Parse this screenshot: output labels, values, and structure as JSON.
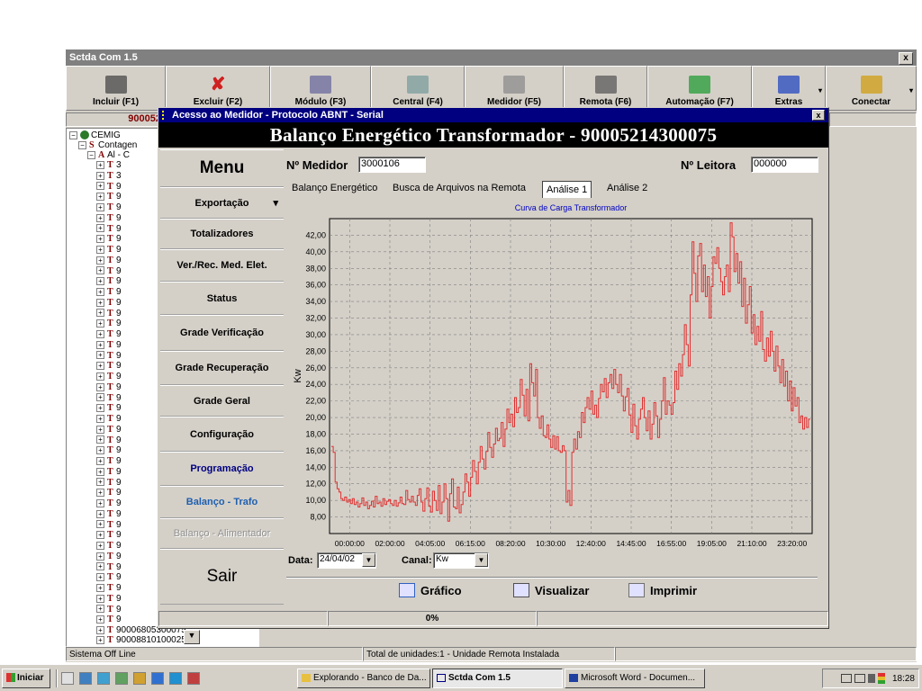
{
  "main_window": {
    "title": "Sctda Com 1.5",
    "close": "x"
  },
  "toolbar": [
    {
      "label": "Incluir (F1)",
      "icon": "document-icon",
      "width": 111
    },
    {
      "label": "Excluir (F2)",
      "icon": "delete-x-icon",
      "width": 116
    },
    {
      "label": "Módulo (F3)",
      "icon": "module-icon",
      "width": 112
    },
    {
      "label": "Central (F4)",
      "icon": "central-icon",
      "width": 104
    },
    {
      "label": "Medidor (F5)",
      "icon": "meter-icon",
      "width": 110
    },
    {
      "label": "Remota (F6)",
      "icon": "remote-icon",
      "width": 93
    },
    {
      "label": "Automação (F7)",
      "icon": "automation-icon",
      "width": 116
    },
    {
      "label": "Extras",
      "icon": "extras-icon",
      "width": 82
    },
    {
      "label": "Conectar",
      "icon": "connect-icon",
      "width": 101
    }
  ],
  "id_box": "900052",
  "tree": {
    "root": "CEMIG",
    "l1": "Contagen",
    "l2": "Al - C",
    "item_digits": [
      "3",
      "3",
      "9",
      "9",
      "9",
      "9",
      "9",
      "9",
      "9",
      "9",
      "9",
      "9",
      "9",
      "9",
      "9",
      "9",
      "9",
      "9",
      "9",
      "9",
      "9",
      "9",
      "9",
      "9",
      "9",
      "9",
      "9",
      "9",
      "9",
      "9",
      "9",
      "9",
      "9",
      "9",
      "9",
      "9",
      "9",
      "9",
      "9",
      "9",
      "9",
      "9",
      "9",
      "9"
    ],
    "bottom_items": [
      "90006805300075",
      "90008810100025"
    ]
  },
  "statusbar": {
    "left": "Sistema Off Line",
    "center": "Total de unidades:1  -  Unidade Remota Instalada"
  },
  "dialog": {
    "title": "Acesso ao Medidor - Protocolo ABNT - Serial",
    "close": "x",
    "banner": "Balanço Energético Transformador - 90005214300075",
    "menu_title": "Menu",
    "menu": [
      {
        "label": "Exportação",
        "arrow": "▾",
        "enabled": true
      },
      {
        "label": "Totalizadores",
        "enabled": true
      },
      {
        "label": "Ver./Rec. Med. Elet.",
        "enabled": true
      },
      {
        "label": "Status",
        "enabled": true
      },
      {
        "label": "Grade Verificação",
        "enabled": true
      },
      {
        "label": "Grade Recuperação",
        "enabled": true
      },
      {
        "label": "Grade Geral",
        "enabled": true
      },
      {
        "label": "Configuração",
        "enabled": true
      },
      {
        "label": "Programação",
        "enabled": true,
        "color": "#000080"
      },
      {
        "label": "Balanço - Trafo",
        "enabled": true,
        "color": "#1f5fb0"
      },
      {
        "label": "Balanço - Alimentador",
        "enabled": false
      }
    ],
    "exit": "Sair",
    "medidor_label": "Nº Medidor",
    "medidor_value": "3000106",
    "leitora_label": "Nº Leitora",
    "leitora_value": "000000",
    "tabs": [
      "Balanço Energético",
      "Busca de Arquivos na Remota",
      "Análise 1",
      "Análise 2"
    ],
    "active_tab": 2,
    "date_label": "Data:",
    "date_value": "24/04/02",
    "canal_label": "Canal:",
    "canal_value": "Kw",
    "buttons": [
      {
        "label": "Gráfico",
        "icon": "chart-icon"
      },
      {
        "label": "Visualizar",
        "icon": "magnifier-icon"
      },
      {
        "label": "Imprimir",
        "icon": "printer-icon"
      }
    ],
    "progress": "0%"
  },
  "chart_data": {
    "type": "line",
    "title": "Curva de Carga Transformador",
    "ylabel": "Kw",
    "xlabel": "",
    "ylim": [
      6,
      44
    ],
    "ytick_labels": [
      "8,00",
      "10,00",
      "12,00",
      "14,00",
      "16,00",
      "18,00",
      "20,00",
      "22,00",
      "24,00",
      "26,00",
      "28,00",
      "30,00",
      "32,00",
      "34,00",
      "36,00",
      "38,00",
      "40,00",
      "42,00"
    ],
    "xtick_labels": [
      "00:00:00",
      "02:00:00",
      "04:05:00",
      "06:15:00",
      "08:20:00",
      "10:30:00",
      "12:40:00",
      "14:45:00",
      "16:55:00",
      "19:05:00",
      "21:10:00",
      "23:20:00"
    ],
    "color": "#e03030",
    "grid": true,
    "values": [
      16.5,
      15.8,
      12.2,
      11.4,
      11.0,
      10.2,
      10.0,
      10.4,
      9.8,
      10.1,
      9.6,
      10.2,
      9.5,
      9.8,
      9.2,
      9.6,
      10.3,
      9.4,
      9.8,
      9.0,
      9.4,
      9.9,
      9.2,
      10.5,
      9.6,
      9.8,
      9.3,
      10.2,
      9.5,
      9.9,
      10.1,
      9.6,
      9.4,
      10.0,
      9.3,
      9.7,
      10.4,
      9.6,
      9.5,
      11.2,
      10.1,
      9.8,
      10.5,
      9.8,
      9.4,
      10.6,
      11.4,
      9.8,
      8.7,
      10.2,
      11.5,
      9.3,
      8.6,
      11.1,
      10.0,
      8.8,
      11.8,
      8.4,
      9.8,
      12.0,
      10.2,
      7.5,
      10.8,
      12.6,
      9.2,
      9.0,
      11.6,
      8.5,
      9.5,
      11.0,
      13.2,
      12.2,
      10.5,
      12.8,
      14.8,
      13.5,
      12.0,
      14.6,
      16.5,
      15.0,
      13.8,
      15.9,
      18.2,
      16.4,
      15.2,
      16.8,
      18.7,
      17.2,
      17.5,
      19.4,
      16.5,
      18.6,
      21.0,
      19.4,
      20.4,
      18.9,
      22.4,
      20.6,
      21.2,
      24.6,
      22.7,
      20.2,
      23.4,
      19.6,
      26.5,
      24.2,
      22.6,
      25.8,
      20.0,
      18.7,
      20.2,
      17.8,
      17.6,
      19.1,
      17.4,
      16.4,
      17.8,
      16.2,
      17.7,
      16.0,
      15.8,
      16.6,
      16.0,
      9.8,
      11.2,
      9.4,
      15.8,
      17.4,
      16.2,
      18.3,
      17.6,
      20.6,
      19.4,
      21.2,
      22.4,
      21.0,
      23.2,
      20.4,
      21.5,
      20.0,
      22.3,
      24.0,
      23.1,
      24.7,
      22.4,
      24.2,
      25.2,
      23.5,
      25.8,
      24.0,
      23.0,
      25.2,
      22.6,
      20.8,
      22.5,
      23.5,
      20.3,
      18.2,
      21.6,
      19.0,
      17.4,
      19.8,
      21.0,
      22.4,
      20.0,
      18.4,
      20.8,
      17.4,
      19.2,
      21.8,
      20.2,
      17.6,
      19.8,
      22.0,
      24.8,
      20.4,
      22.0,
      21.5,
      20.4,
      21.8,
      25.6,
      23.4,
      26.5,
      25.0,
      27.6,
      31.2,
      28.8,
      26.2,
      34.8,
      41.2,
      37.4,
      34.0,
      39.5,
      41.0,
      35.2,
      38.4,
      34.6,
      37.0,
      32.0,
      35.8,
      39.4,
      38.6,
      40.5,
      38.0,
      36.4,
      34.8,
      37.0,
      38.4,
      35.2,
      43.5,
      41.8,
      37.6,
      39.8,
      36.2,
      38.8,
      33.4,
      36.8,
      31.4,
      33.6,
      35.8,
      30.2,
      32.4,
      28.8,
      31.0,
      29.2,
      32.8,
      28.2,
      26.8,
      29.6,
      27.4,
      30.4,
      28.0,
      25.6,
      28.6,
      26.2,
      24.2,
      27.0,
      23.8,
      25.6,
      22.0,
      24.4,
      20.8,
      23.6,
      21.4,
      22.4,
      19.4,
      20.2,
      18.6,
      20.0,
      18.8,
      19.8
    ]
  },
  "taskbar": {
    "start": "Iniciar",
    "tasks": [
      "Explorando - Banco de Da...",
      "Sctda Com 1.5",
      "Microsoft Word - Documen..."
    ],
    "clock": "18:28"
  }
}
